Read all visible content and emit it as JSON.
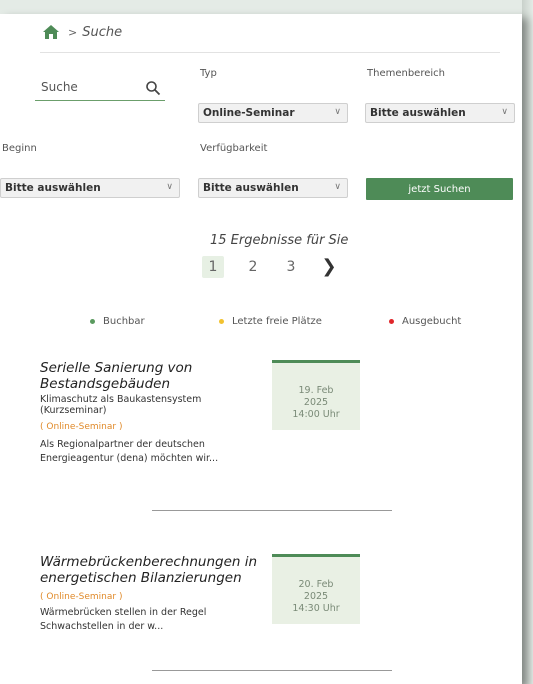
{
  "breadcrumb": {
    "separator": ">",
    "current": "Suche"
  },
  "filters": {
    "search_placeholder": "Suche",
    "typ_label": "Typ",
    "typ_value": "Online-Seminar",
    "themenbereich_label": "Themenbereich",
    "themenbereich_value": "Bitte auswählen",
    "beginn_label": "Beginn",
    "beginn_value": "Bitte auswählen",
    "verfuegbarkeit_label": "Verfügbarkeit",
    "verfuegbarkeit_value": "Bitte auswählen",
    "submit_label": "jetzt Suchen"
  },
  "results": {
    "count_text": "15 Ergebnisse für Sie",
    "pages": [
      "1",
      "2",
      "3"
    ],
    "next_symbol": "❯"
  },
  "legend": [
    {
      "label": "Buchbar",
      "color": "#5a9a5f"
    },
    {
      "label": "Letzte freie Plätze",
      "color": "#f2c230"
    },
    {
      "label": "Ausgebucht",
      "color": "#e0262a"
    }
  ],
  "events": [
    {
      "title_line1": "Serielle Sanierung von",
      "title_line2": "Bestandsgebäuden",
      "subtitle_line1": "Klimaschutz als Baukastensystem",
      "subtitle_line2": "(Kurzseminar)",
      "type": "( Online-Seminar )",
      "desc_line1": "Als Regionalpartner der deutschen",
      "desc_line2": "Energieagentur (dena) möchten wir...",
      "date": "19. Feb",
      "year": "2025",
      "time": "14:00 Uhr"
    },
    {
      "title_line1": "Wärmebrückenberechnungen in",
      "title_line2": "energetischen Bilanzierungen",
      "type": "( Online-Seminar )",
      "desc_line1": "Wärmebrücken stellen in der Regel",
      "desc_line2": "Schwachstellen in der w...",
      "date": "20. Feb",
      "year": "2025",
      "time": "14:30 Uhr"
    }
  ],
  "colors": {
    "accent": "#4e8b57",
    "type_orange": "#e08a2a",
    "date_bg": "#e9f0e4"
  }
}
